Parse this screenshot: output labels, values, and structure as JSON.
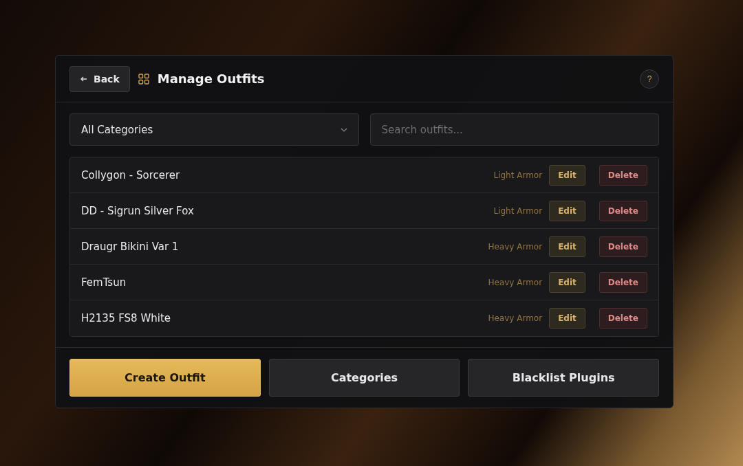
{
  "header": {
    "back_label": "Back",
    "title": "Manage Outfits",
    "help_label": "?"
  },
  "filters": {
    "category": {
      "value": "All Categories"
    },
    "search": {
      "placeholder": "Search outfits..."
    }
  },
  "outfits": [
    {
      "name": "Collygon - Sorcerer",
      "category": "Light Armor",
      "edit_label": "Edit",
      "delete_label": "Delete"
    },
    {
      "name": "DD - Sigrun Silver Fox",
      "category": "Light Armor",
      "edit_label": "Edit",
      "delete_label": "Delete"
    },
    {
      "name": "Draugr Bikini Var 1",
      "category": "Heavy Armor",
      "edit_label": "Edit",
      "delete_label": "Delete"
    },
    {
      "name": "FemTsun",
      "category": "Heavy Armor",
      "edit_label": "Edit",
      "delete_label": "Delete"
    },
    {
      "name": "H2135 FS8 White",
      "category": "Heavy Armor",
      "edit_label": "Edit",
      "delete_label": "Delete"
    }
  ],
  "footer_buttons": [
    {
      "label": "Create Outfit",
      "kind": "primary"
    },
    {
      "label": "Categories",
      "kind": "secondary"
    },
    {
      "label": "Blacklist Plugins",
      "kind": "secondary"
    }
  ]
}
